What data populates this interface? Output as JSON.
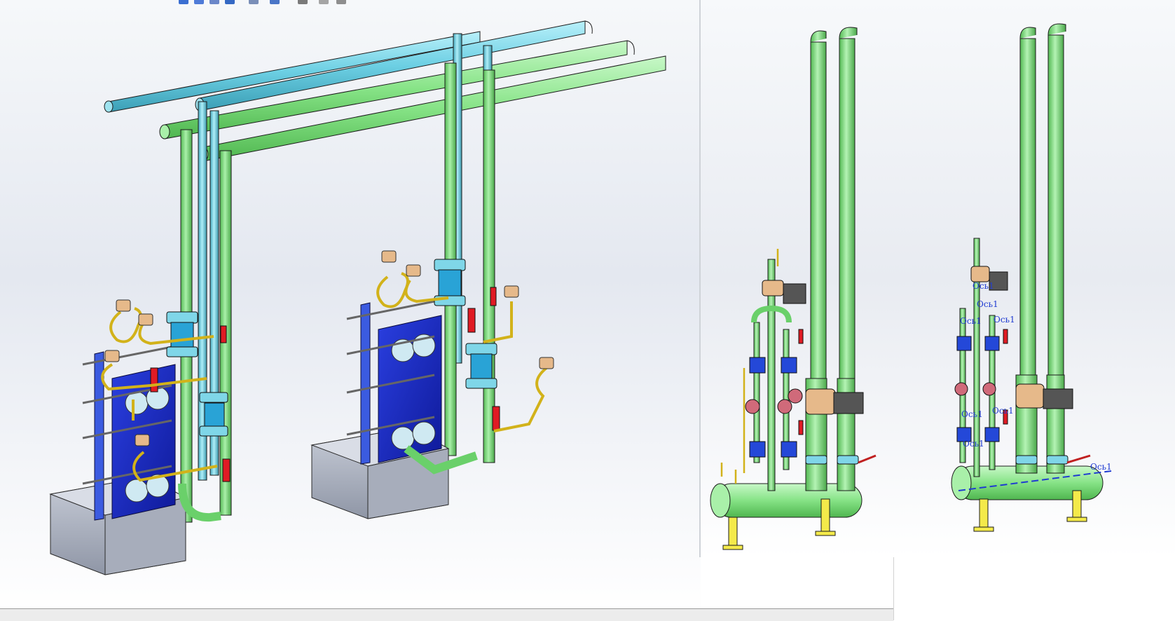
{
  "app": {
    "type": "3D CAD assembly view"
  },
  "views": {
    "main": {
      "name": "isometric-assembly-view"
    },
    "middle": {
      "name": "manifold-assembly-view"
    },
    "right": {
      "name": "manifold-assembly-view-with-axes"
    }
  },
  "annotations": {
    "axis_label": "Ось1",
    "axis_labels_right": [
      "Ось1",
      "Ось1",
      "Ось1",
      "Ось1",
      "Ось1",
      "Ось1",
      "Ось1",
      "Ось1"
    ]
  },
  "colors": {
    "pipe_blue": "#7fd6e8",
    "pipe_green": "#8fea8f",
    "exchanger_blue": "#2030c8",
    "frame_blue": "#3b5be0",
    "base_grey": "#aeb4c2",
    "impulse_yellow": "#f2d23a",
    "valve_red": "#e01b24",
    "fitting_bronze": "#e6b98a",
    "support_yellow": "#f4ea4a",
    "axis_blue": "#1f3bd1"
  }
}
